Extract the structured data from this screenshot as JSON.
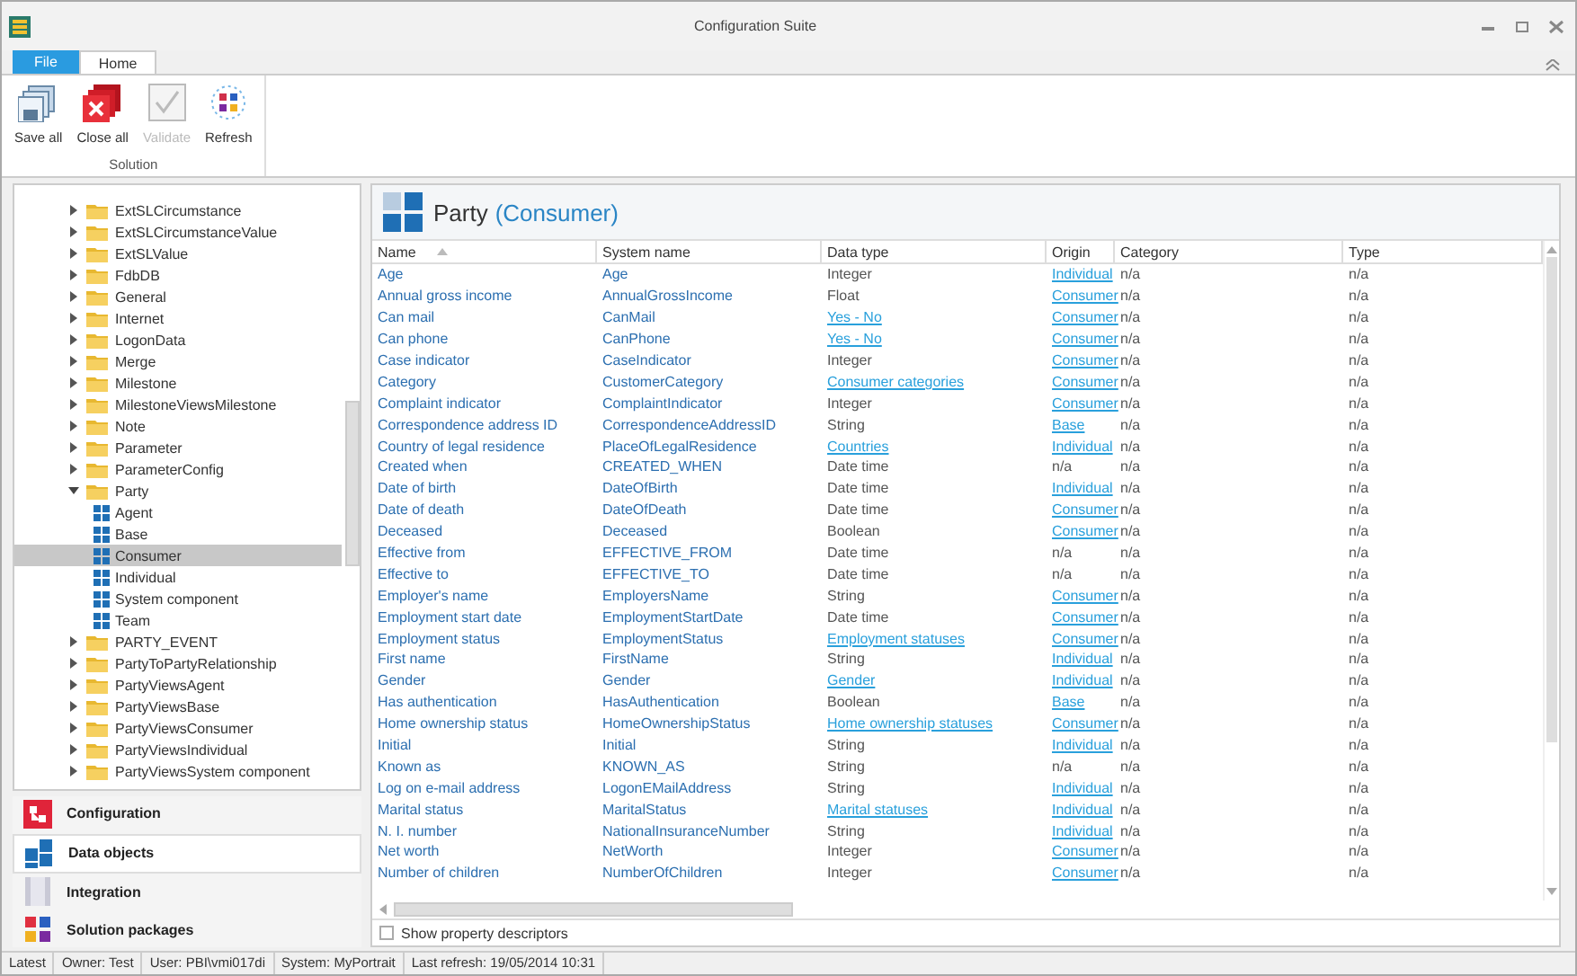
{
  "window": {
    "title": "Configuration Suite"
  },
  "ribbon_tabs": [
    {
      "label": "File",
      "kind": "file",
      "selected": false
    },
    {
      "label": "Home",
      "kind": "tab",
      "selected": true
    }
  ],
  "ribbon": {
    "group": "Solution",
    "buttons": [
      {
        "label": "Save all",
        "kind": "save",
        "disabled": false
      },
      {
        "label": "Close all",
        "kind": "close",
        "disabled": false
      },
      {
        "label": "Validate",
        "kind": "validate",
        "disabled": true
      },
      {
        "label": "Refresh",
        "kind": "refresh",
        "disabled": false
      }
    ]
  },
  "tree": [
    {
      "label": "ExtSLCircumstance",
      "expanded": false
    },
    {
      "label": "ExtSLCircumstanceValue",
      "expanded": false
    },
    {
      "label": "ExtSLValue",
      "expanded": false
    },
    {
      "label": "FdbDB",
      "expanded": false
    },
    {
      "label": "General",
      "expanded": false
    },
    {
      "label": "Internet",
      "expanded": false
    },
    {
      "label": "LogonData",
      "expanded": false
    },
    {
      "label": "Merge",
      "expanded": false
    },
    {
      "label": "Milestone",
      "expanded": false
    },
    {
      "label": "MilestoneViewsMilestone",
      "expanded": false
    },
    {
      "label": "Note",
      "expanded": false
    },
    {
      "label": "Parameter",
      "expanded": false
    },
    {
      "label": "ParameterConfig",
      "expanded": false
    },
    {
      "label": "Party",
      "expanded": true,
      "children": [
        {
          "label": "Agent",
          "selected": false
        },
        {
          "label": "Base",
          "selected": false
        },
        {
          "label": "Consumer",
          "selected": true
        },
        {
          "label": "Individual",
          "selected": false
        },
        {
          "label": "System component",
          "selected": false
        },
        {
          "label": "Team",
          "selected": false
        }
      ]
    },
    {
      "label": "PARTY_EVENT",
      "expanded": false
    },
    {
      "label": "PartyToPartyRelationship",
      "expanded": false
    },
    {
      "label": "PartyViewsAgent",
      "expanded": false
    },
    {
      "label": "PartyViewsBase",
      "expanded": false
    },
    {
      "label": "PartyViewsConsumer",
      "expanded": false
    },
    {
      "label": "PartyViewsIndividual",
      "expanded": false
    },
    {
      "label": "PartyViewsSystem component",
      "expanded": false
    }
  ],
  "nav": [
    {
      "label": "Configuration",
      "kind": "configuration",
      "selected": false
    },
    {
      "label": "Data objects",
      "kind": "data",
      "selected": true
    },
    {
      "label": "Integration",
      "kind": "integration",
      "selected": false
    },
    {
      "label": "Solution packages",
      "kind": "packages",
      "selected": false
    }
  ],
  "panel": {
    "title": "Party",
    "subtitle": "(Consumer)"
  },
  "table": {
    "columns": [
      "Name",
      "System name",
      "Data type",
      "Origin",
      "Category",
      "Type"
    ],
    "rows": [
      {
        "name": "Age",
        "system_name": "Age",
        "data_type": "Integer",
        "data_type_link": false,
        "origin": "Individual",
        "origin_link": true,
        "category": "n/a",
        "type": "n/a"
      },
      {
        "name": "Annual gross income",
        "system_name": "AnnualGrossIncome",
        "data_type": "Float",
        "data_type_link": false,
        "origin": "Consumer",
        "origin_link": true,
        "category": "n/a",
        "type": "n/a"
      },
      {
        "name": "Can mail",
        "system_name": "CanMail",
        "data_type": "Yes - No",
        "data_type_link": true,
        "origin": "Consumer",
        "origin_link": true,
        "category": "n/a",
        "type": "n/a"
      },
      {
        "name": "Can phone",
        "system_name": "CanPhone",
        "data_type": "Yes - No",
        "data_type_link": true,
        "origin": "Consumer",
        "origin_link": true,
        "category": "n/a",
        "type": "n/a"
      },
      {
        "name": "Case indicator",
        "system_name": "CaseIndicator",
        "data_type": "Integer",
        "data_type_link": false,
        "origin": "Consumer",
        "origin_link": true,
        "category": "n/a",
        "type": "n/a"
      },
      {
        "name": "Category",
        "system_name": "CustomerCategory",
        "data_type": "Consumer categories",
        "data_type_link": true,
        "origin": "Consumer",
        "origin_link": true,
        "category": "n/a",
        "type": "n/a"
      },
      {
        "name": "Complaint indicator",
        "system_name": "ComplaintIndicator",
        "data_type": "Integer",
        "data_type_link": false,
        "origin": "Consumer",
        "origin_link": true,
        "category": "n/a",
        "type": "n/a"
      },
      {
        "name": "Correspondence address ID",
        "system_name": "CorrespondenceAddressID",
        "data_type": "String",
        "data_type_link": false,
        "origin": "Base",
        "origin_link": true,
        "category": "n/a",
        "type": "n/a"
      },
      {
        "name": "Country of legal residence",
        "system_name": "PlaceOfLegalResidence",
        "data_type": "Countries",
        "data_type_link": true,
        "origin": "Individual",
        "origin_link": true,
        "category": "n/a",
        "type": "n/a"
      },
      {
        "name": "Created when",
        "system_name": "CREATED_WHEN",
        "data_type": "Date time",
        "data_type_link": false,
        "origin": "n/a",
        "origin_link": false,
        "category": "n/a",
        "type": "n/a"
      },
      {
        "name": "Date of birth",
        "system_name": "DateOfBirth",
        "data_type": "Date time",
        "data_type_link": false,
        "origin": "Individual",
        "origin_link": true,
        "category": "n/a",
        "type": "n/a"
      },
      {
        "name": "Date of death",
        "system_name": "DateOfDeath",
        "data_type": "Date time",
        "data_type_link": false,
        "origin": "Consumer",
        "origin_link": true,
        "category": "n/a",
        "type": "n/a"
      },
      {
        "name": "Deceased",
        "system_name": "Deceased",
        "data_type": "Boolean",
        "data_type_link": false,
        "origin": "Consumer",
        "origin_link": true,
        "category": "n/a",
        "type": "n/a"
      },
      {
        "name": "Effective from",
        "system_name": "EFFECTIVE_FROM",
        "data_type": "Date time",
        "data_type_link": false,
        "origin": "n/a",
        "origin_link": false,
        "category": "n/a",
        "type": "n/a"
      },
      {
        "name": "Effective to",
        "system_name": "EFFECTIVE_TO",
        "data_type": "Date time",
        "data_type_link": false,
        "origin": "n/a",
        "origin_link": false,
        "category": "n/a",
        "type": "n/a"
      },
      {
        "name": "Employer's name",
        "system_name": "EmployersName",
        "data_type": "String",
        "data_type_link": false,
        "origin": "Consumer",
        "origin_link": true,
        "category": "n/a",
        "type": "n/a"
      },
      {
        "name": "Employment start date",
        "system_name": "EmploymentStartDate",
        "data_type": "Date time",
        "data_type_link": false,
        "origin": "Consumer",
        "origin_link": true,
        "category": "n/a",
        "type": "n/a"
      },
      {
        "name": "Employment status",
        "system_name": "EmploymentStatus",
        "data_type": "Employment statuses",
        "data_type_link": true,
        "origin": "Consumer",
        "origin_link": true,
        "category": "n/a",
        "type": "n/a"
      },
      {
        "name": "First name",
        "system_name": "FirstName",
        "data_type": "String",
        "data_type_link": false,
        "origin": "Individual",
        "origin_link": true,
        "category": "n/a",
        "type": "n/a"
      },
      {
        "name": "Gender",
        "system_name": "Gender",
        "data_type": "Gender",
        "data_type_link": true,
        "origin": "Individual",
        "origin_link": true,
        "category": "n/a",
        "type": "n/a"
      },
      {
        "name": "Has authentication",
        "system_name": "HasAuthentication",
        "data_type": "Boolean",
        "data_type_link": false,
        "origin": "Base",
        "origin_link": true,
        "category": "n/a",
        "type": "n/a"
      },
      {
        "name": "Home ownership status",
        "system_name": "HomeOwnershipStatus",
        "data_type": "Home ownership statuses",
        "data_type_link": true,
        "origin": "Consumer",
        "origin_link": true,
        "category": "n/a",
        "type": "n/a"
      },
      {
        "name": "Initial",
        "system_name": "Initial",
        "data_type": "String",
        "data_type_link": false,
        "origin": "Individual",
        "origin_link": true,
        "category": "n/a",
        "type": "n/a"
      },
      {
        "name": "Known as",
        "system_name": "KNOWN_AS",
        "data_type": "String",
        "data_type_link": false,
        "origin": "n/a",
        "origin_link": false,
        "category": "n/a",
        "type": "n/a"
      },
      {
        "name": "Log on e-mail address",
        "system_name": "LogonEMailAddress",
        "data_type": "String",
        "data_type_link": false,
        "origin": "Individual",
        "origin_link": true,
        "category": "n/a",
        "type": "n/a"
      },
      {
        "name": "Marital status",
        "system_name": "MaritalStatus",
        "data_type": "Marital statuses",
        "data_type_link": true,
        "origin": "Individual",
        "origin_link": true,
        "category": "n/a",
        "type": "n/a"
      },
      {
        "name": "N. I. number",
        "system_name": "NationalInsuranceNumber",
        "data_type": "String",
        "data_type_link": false,
        "origin": "Individual",
        "origin_link": true,
        "category": "n/a",
        "type": "n/a"
      },
      {
        "name": "Net worth",
        "system_name": "NetWorth",
        "data_type": "Integer",
        "data_type_link": false,
        "origin": "Consumer",
        "origin_link": true,
        "category": "n/a",
        "type": "n/a"
      },
      {
        "name": "Number of children",
        "system_name": "NumberOfChildren",
        "data_type": "Integer",
        "data_type_link": false,
        "origin": "Consumer",
        "origin_link": true,
        "category": "n/a",
        "type": "n/a"
      }
    ]
  },
  "show_descriptors": {
    "label": "Show property descriptors",
    "checked": false
  },
  "status_bar": [
    "Latest",
    "Owner: Test",
    "User: PBI\\vmi017di",
    "System: MyPortrait",
    "Last refresh: 19/05/2014 10:31"
  ]
}
